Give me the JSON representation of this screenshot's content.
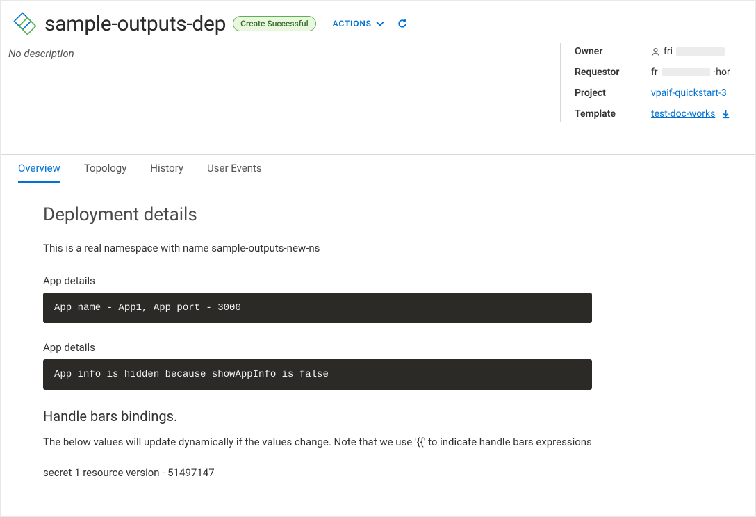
{
  "header": {
    "title": "sample-outputs-dep",
    "status": "Create Successful",
    "actions_label": "ACTIONS"
  },
  "description_placeholder": "No description",
  "info": {
    "owner_label": "Owner",
    "owner_value": "fri",
    "requestor_label": "Requestor",
    "requestor_value": "fr",
    "requestor_suffix": "·hor",
    "project_label": "Project",
    "project_value": "vpaif-quickstart-3",
    "template_label": "Template",
    "template_value": "test-doc-works"
  },
  "tabs": [
    "Overview",
    "Topology",
    "History",
    "User Events"
  ],
  "active_tab": 0,
  "details": {
    "heading": "Deployment details",
    "namespace_text": "This is a real namespace with name sample-outputs-new-ns",
    "app_details_label": "App details",
    "code1": "App name - App1, App port - 3000",
    "code2": "App info is hidden because showAppInfo is false",
    "bindings_heading": "Handle bars bindings.",
    "bindings_text": "The below values will update dynamically if the values change. Note that we use '{{' to indicate handle bars expressions",
    "secret_text": "secret 1 resource version - 51497147"
  }
}
